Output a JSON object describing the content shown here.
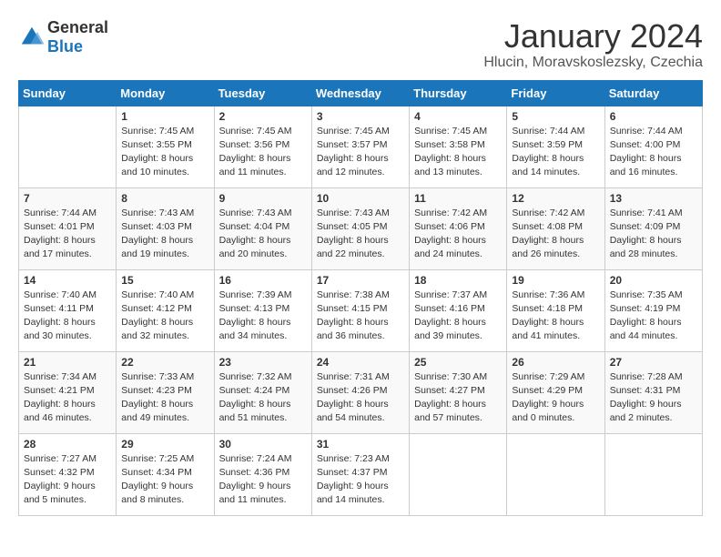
{
  "logo": {
    "general": "General",
    "blue": "Blue"
  },
  "title": "January 2024",
  "subtitle": "Hlucin, Moravskoslezsky, Czechia",
  "days_of_week": [
    "Sunday",
    "Monday",
    "Tuesday",
    "Wednesday",
    "Thursday",
    "Friday",
    "Saturday"
  ],
  "weeks": [
    [
      {
        "day": "",
        "info": ""
      },
      {
        "day": "1",
        "info": "Sunrise: 7:45 AM\nSunset: 3:55 PM\nDaylight: 8 hours\nand 10 minutes."
      },
      {
        "day": "2",
        "info": "Sunrise: 7:45 AM\nSunset: 3:56 PM\nDaylight: 8 hours\nand 11 minutes."
      },
      {
        "day": "3",
        "info": "Sunrise: 7:45 AM\nSunset: 3:57 PM\nDaylight: 8 hours\nand 12 minutes."
      },
      {
        "day": "4",
        "info": "Sunrise: 7:45 AM\nSunset: 3:58 PM\nDaylight: 8 hours\nand 13 minutes."
      },
      {
        "day": "5",
        "info": "Sunrise: 7:44 AM\nSunset: 3:59 PM\nDaylight: 8 hours\nand 14 minutes."
      },
      {
        "day": "6",
        "info": "Sunrise: 7:44 AM\nSunset: 4:00 PM\nDaylight: 8 hours\nand 16 minutes."
      }
    ],
    [
      {
        "day": "7",
        "info": "Sunrise: 7:44 AM\nSunset: 4:01 PM\nDaylight: 8 hours\nand 17 minutes."
      },
      {
        "day": "8",
        "info": "Sunrise: 7:43 AM\nSunset: 4:03 PM\nDaylight: 8 hours\nand 19 minutes."
      },
      {
        "day": "9",
        "info": "Sunrise: 7:43 AM\nSunset: 4:04 PM\nDaylight: 8 hours\nand 20 minutes."
      },
      {
        "day": "10",
        "info": "Sunrise: 7:43 AM\nSunset: 4:05 PM\nDaylight: 8 hours\nand 22 minutes."
      },
      {
        "day": "11",
        "info": "Sunrise: 7:42 AM\nSunset: 4:06 PM\nDaylight: 8 hours\nand 24 minutes."
      },
      {
        "day": "12",
        "info": "Sunrise: 7:42 AM\nSunset: 4:08 PM\nDaylight: 8 hours\nand 26 minutes."
      },
      {
        "day": "13",
        "info": "Sunrise: 7:41 AM\nSunset: 4:09 PM\nDaylight: 8 hours\nand 28 minutes."
      }
    ],
    [
      {
        "day": "14",
        "info": "Sunrise: 7:40 AM\nSunset: 4:11 PM\nDaylight: 8 hours\nand 30 minutes."
      },
      {
        "day": "15",
        "info": "Sunrise: 7:40 AM\nSunset: 4:12 PM\nDaylight: 8 hours\nand 32 minutes."
      },
      {
        "day": "16",
        "info": "Sunrise: 7:39 AM\nSunset: 4:13 PM\nDaylight: 8 hours\nand 34 minutes."
      },
      {
        "day": "17",
        "info": "Sunrise: 7:38 AM\nSunset: 4:15 PM\nDaylight: 8 hours\nand 36 minutes."
      },
      {
        "day": "18",
        "info": "Sunrise: 7:37 AM\nSunset: 4:16 PM\nDaylight: 8 hours\nand 39 minutes."
      },
      {
        "day": "19",
        "info": "Sunrise: 7:36 AM\nSunset: 4:18 PM\nDaylight: 8 hours\nand 41 minutes."
      },
      {
        "day": "20",
        "info": "Sunrise: 7:35 AM\nSunset: 4:19 PM\nDaylight: 8 hours\nand 44 minutes."
      }
    ],
    [
      {
        "day": "21",
        "info": "Sunrise: 7:34 AM\nSunset: 4:21 PM\nDaylight: 8 hours\nand 46 minutes."
      },
      {
        "day": "22",
        "info": "Sunrise: 7:33 AM\nSunset: 4:23 PM\nDaylight: 8 hours\nand 49 minutes."
      },
      {
        "day": "23",
        "info": "Sunrise: 7:32 AM\nSunset: 4:24 PM\nDaylight: 8 hours\nand 51 minutes."
      },
      {
        "day": "24",
        "info": "Sunrise: 7:31 AM\nSunset: 4:26 PM\nDaylight: 8 hours\nand 54 minutes."
      },
      {
        "day": "25",
        "info": "Sunrise: 7:30 AM\nSunset: 4:27 PM\nDaylight: 8 hours\nand 57 minutes."
      },
      {
        "day": "26",
        "info": "Sunrise: 7:29 AM\nSunset: 4:29 PM\nDaylight: 9 hours\nand 0 minutes."
      },
      {
        "day": "27",
        "info": "Sunrise: 7:28 AM\nSunset: 4:31 PM\nDaylight: 9 hours\nand 2 minutes."
      }
    ],
    [
      {
        "day": "28",
        "info": "Sunrise: 7:27 AM\nSunset: 4:32 PM\nDaylight: 9 hours\nand 5 minutes."
      },
      {
        "day": "29",
        "info": "Sunrise: 7:25 AM\nSunset: 4:34 PM\nDaylight: 9 hours\nand 8 minutes."
      },
      {
        "day": "30",
        "info": "Sunrise: 7:24 AM\nSunset: 4:36 PM\nDaylight: 9 hours\nand 11 minutes."
      },
      {
        "day": "31",
        "info": "Sunrise: 7:23 AM\nSunset: 4:37 PM\nDaylight: 9 hours\nand 14 minutes."
      },
      {
        "day": "",
        "info": ""
      },
      {
        "day": "",
        "info": ""
      },
      {
        "day": "",
        "info": ""
      }
    ]
  ]
}
